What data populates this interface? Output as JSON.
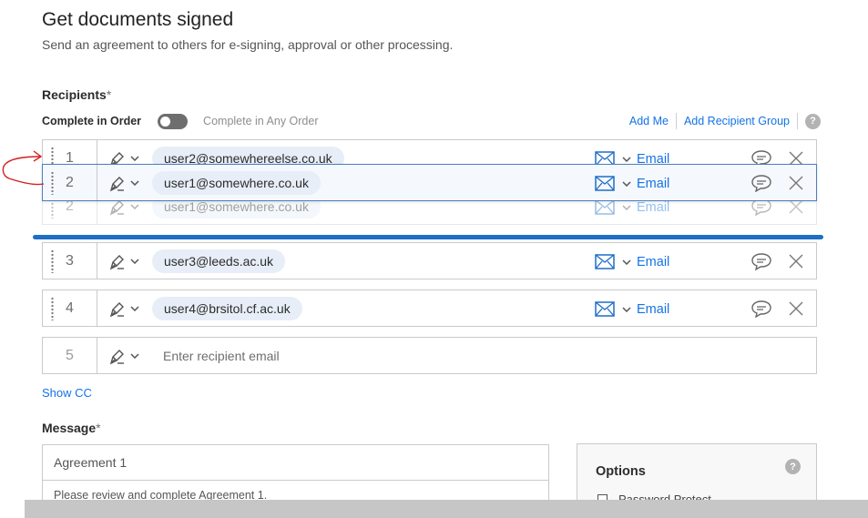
{
  "page": {
    "title": "Get documents signed",
    "subtitle": "Send an agreement to others for e-signing, approval or other processing."
  },
  "recipients": {
    "label": "Recipients",
    "required_mark": "*",
    "order_sequential": "Complete in Order",
    "order_any": "Complete in Any Order",
    "add_me": "Add Me",
    "add_group": "Add Recipient Group",
    "help": "?",
    "rows": [
      {
        "number": "1",
        "email": "user2@somewhereelse.co.uk",
        "auth": "Email"
      },
      {
        "number": "2",
        "email": "user1@somewhere.co.uk",
        "auth": "Email"
      },
      {
        "number": "2",
        "email": "user1@somewhere.co.uk",
        "auth": "Email"
      },
      {
        "number": "3",
        "email": "user3@leeds.ac.uk",
        "auth": "Email"
      },
      {
        "number": "4",
        "email": "user4@brsitol.cf.ac.uk",
        "auth": "Email"
      },
      {
        "number": "5",
        "placeholder": "Enter recipient email"
      }
    ]
  },
  "show_cc": "Show CC",
  "message": {
    "label": "Message",
    "required_mark": "*",
    "agreement_name": "Agreement 1",
    "body": "Please review and complete Agreement 1."
  },
  "options": {
    "title": "Options",
    "help": "?",
    "items": [
      "Password Protect"
    ]
  },
  "colors": {
    "accent": "#1473e6",
    "drop_indicator": "#1f6ec5",
    "annotation": "#d42020"
  },
  "icons": [
    "signer-pen-icon",
    "chevron-down-icon",
    "envelope-icon",
    "comment-icon",
    "close-icon",
    "drag-handle-icon",
    "help-icon"
  ]
}
